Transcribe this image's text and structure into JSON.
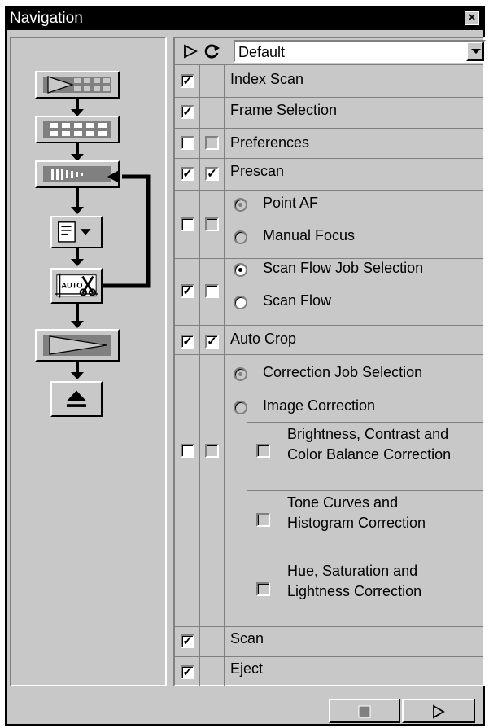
{
  "window": {
    "title": "Navigation",
    "close_symbol": "×"
  },
  "flow_buttons": [
    {
      "name": "index-scan-icon"
    },
    {
      "name": "frame-selection-icon"
    },
    {
      "name": "prescan-icon"
    },
    {
      "name": "job-selection-icon"
    },
    {
      "name": "auto-crop-icon",
      "text": "AUTO"
    },
    {
      "name": "scan-icon"
    },
    {
      "name": "eject-icon"
    }
  ],
  "header": {
    "selected_profile": "Default"
  },
  "rows": [
    {
      "label": "Index Scan",
      "col1": true
    },
    {
      "label": "Frame Selection",
      "col1": true
    },
    {
      "label": "Preferences",
      "col1": false,
      "col2": false
    },
    {
      "label": "Prescan",
      "col1": true,
      "col2": true
    },
    {
      "options": [
        "Point AF",
        "Manual Focus"
      ],
      "selected": 0,
      "disabled": true
    },
    {
      "options": [
        "Scan Flow Job Selection",
        "Scan Flow"
      ],
      "selected": 0
    },
    {
      "label": "Auto Crop",
      "col1": true,
      "col2": true
    },
    {
      "options": [
        "Correction Job Selection",
        "Image Correction"
      ],
      "selected": 0,
      "disabled": true,
      "sub_options": [
        "Brightness, Contrast and Color Balance Correction",
        "Tone Curves and Histogram Correction",
        "Hue, Saturation and Lightness Correction"
      ]
    },
    {
      "label": "Scan",
      "col1": true
    },
    {
      "label": "Eject",
      "col1": true
    }
  ],
  "colors": {
    "face": "#c8c8c8",
    "shadow": "#808080",
    "title_bg": "#000000"
  }
}
